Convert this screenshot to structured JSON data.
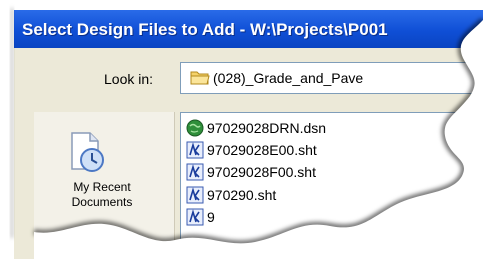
{
  "window": {
    "title": "Select Design Files to Add - W:\\Projects\\P001"
  },
  "lookin": {
    "label": "Look in:",
    "value": "(028)_Grade_and_Pave"
  },
  "places": {
    "recent_label": "My Recent\nDocuments"
  },
  "files": [
    {
      "name": "97029028DRN.dsn",
      "icon": "globe-file-icon"
    },
    {
      "name": "97029028E00.sht",
      "icon": "sheet-file-icon"
    },
    {
      "name": "97029028F00.sht",
      "icon": "sheet-file-icon"
    },
    {
      "name": "970290.sht",
      "icon": "sheet-file-icon"
    },
    {
      "name": "9",
      "icon": "sheet-file-icon"
    }
  ],
  "colors": {
    "title_bar": "#0f4fd6",
    "dialog_bg": "#ece9d8",
    "border": "#7f9db9"
  }
}
